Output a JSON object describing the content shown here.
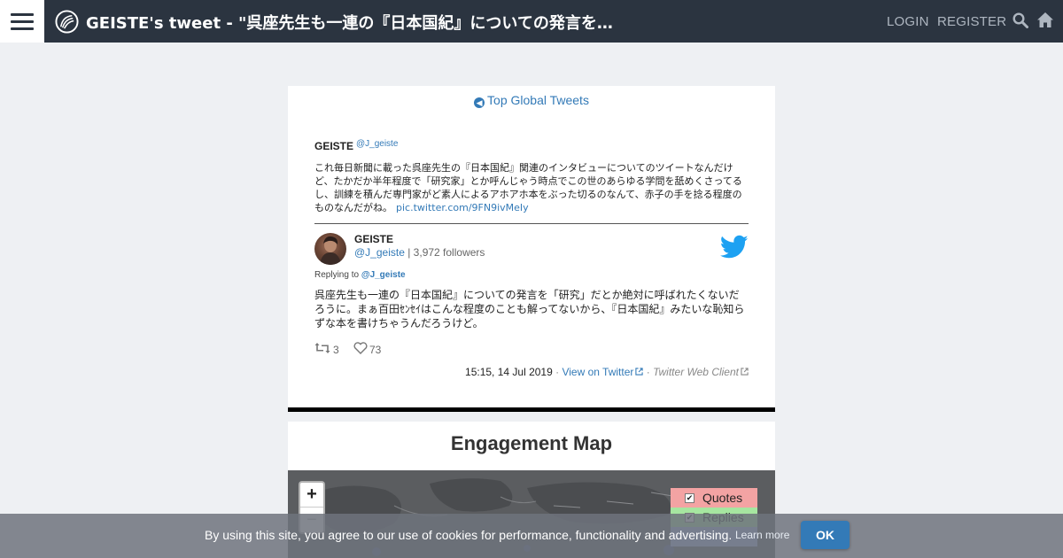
{
  "header": {
    "title": "GEISTE's tweet - \"呉座先生も一連の『日本国紀』についての発言を「...",
    "login_label": "LOGIN",
    "register_label": "REGISTER",
    "icons": [
      "menu-icon",
      "site-logo-icon",
      "search-icon",
      "home-icon"
    ]
  },
  "card": {
    "top_link": "Top Global Tweets",
    "quoted": {
      "name": "GEISTE",
      "handle": "@J_geiste",
      "text": "これ毎日新聞に載った呉座先生の『日本国紀』関連のインタビューについてのツイートなんだけど、たかだか半年程度で「研究家」とか呼んじゃう時点でこの世のあらゆる学問を舐めくさってるし、訓練を積んだ専門家がど素人によるアホアホ本をぶった切るのなんて、赤子の手を捻る程度のものなんだがね。",
      "link": "pic.twitter.com/9FN9ivMeIy"
    },
    "author": {
      "name": "GEISTE",
      "handle": "@J_geiste",
      "followers": "| 3,972 followers"
    },
    "replying_label": "Replying to",
    "replying_to": "@J_geiste",
    "text": "呉座先生も一連の『日本国紀』についての発言を「研究」だとか絶対に呼ばれたくないだろうに。まぁ百田ｾﾝｾｲはこんな程度のことも解ってないから、『日本国紀』みたいな恥知らずな本を書けちゃうんだろうけど。",
    "retweets": "3",
    "likes": "73",
    "timestamp": "15:15, 14 Jul 2019",
    "sep": "·",
    "view_on_twitter": "View on Twitter",
    "client": "Twitter Web Client"
  },
  "map": {
    "title": "Engagement Map",
    "zoom_in": "+",
    "zoom_out": "−",
    "legend": [
      {
        "label": "Quotes",
        "color": "#f3a3a3",
        "checked": true
      },
      {
        "label": "Replies",
        "color": "#a6e6a0",
        "checked": true
      }
    ]
  },
  "cookie": {
    "text": "By using this site, you agree to our use of cookies for performance, functionality and advertising.",
    "learn_more": "Learn more",
    "ok": "OK"
  },
  "colors": {
    "topbar": "#2b3440",
    "link": "#337ab7",
    "twitter": "#1da1f2"
  }
}
